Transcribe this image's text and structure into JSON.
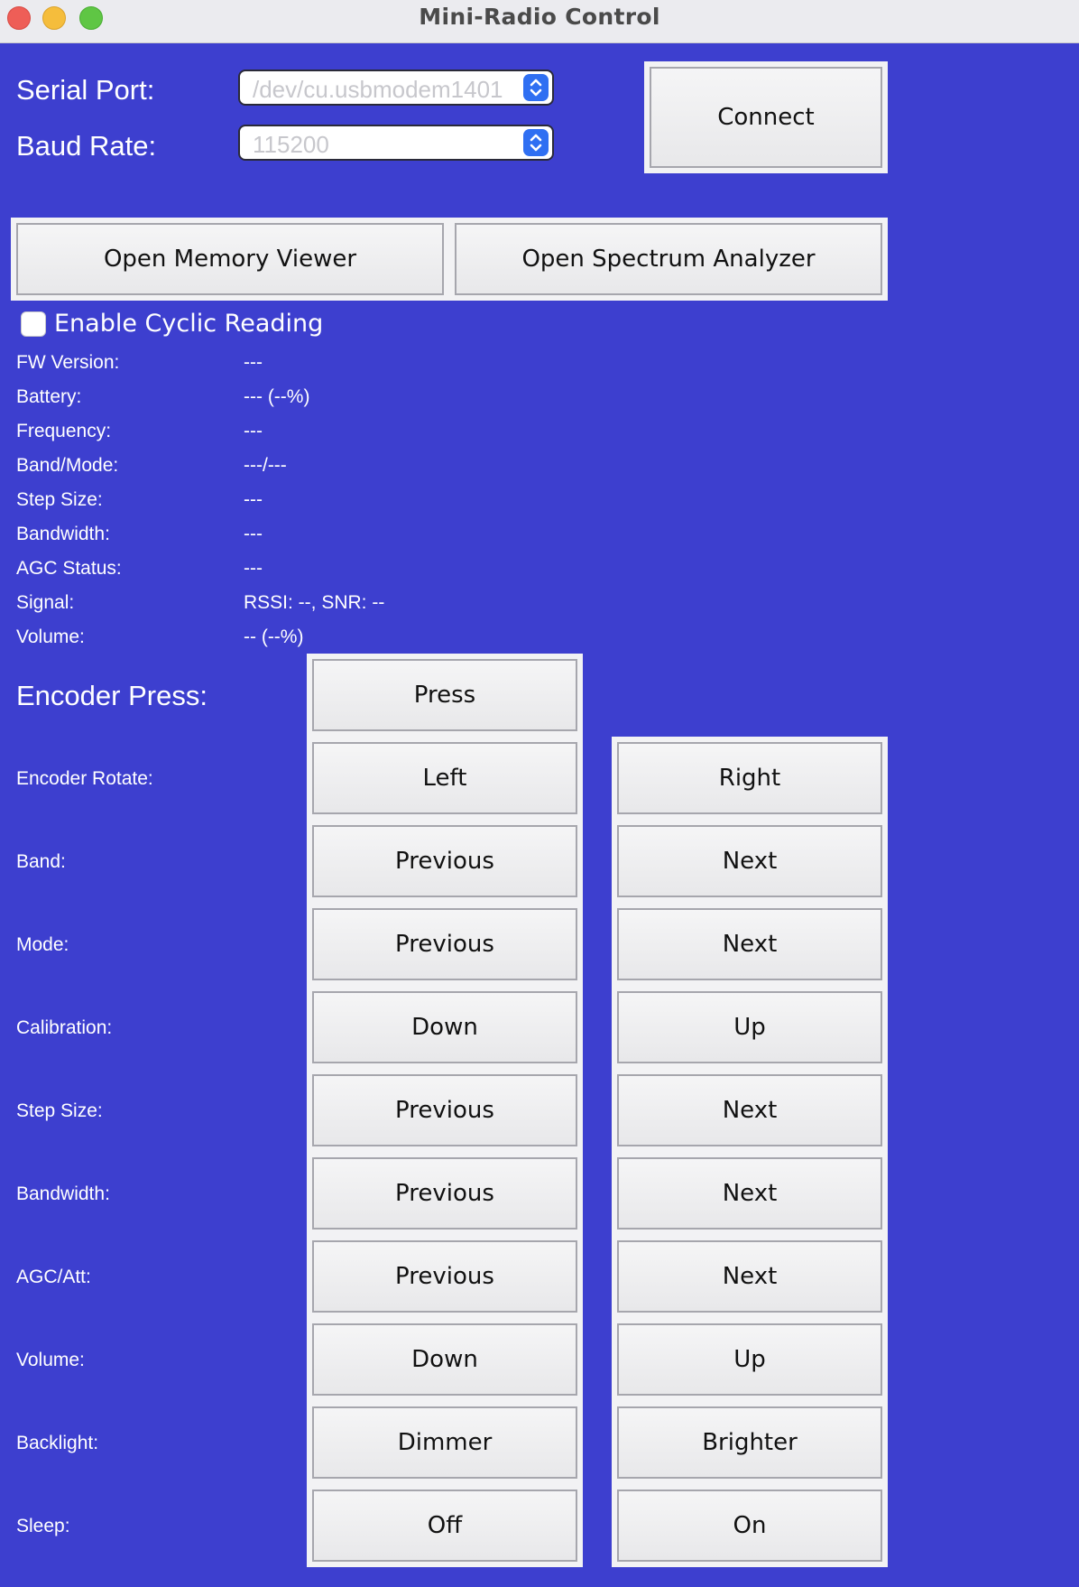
{
  "window": {
    "title": "Mini-Radio Control"
  },
  "connection": {
    "serial_port_label": "Serial Port:",
    "serial_port_value": "/dev/cu.usbmodem1401",
    "baud_rate_label": "Baud Rate:",
    "baud_rate_value": "115200",
    "connect_label": "Connect"
  },
  "tools": {
    "memory_viewer_label": "Open Memory Viewer",
    "spectrum_analyzer_label": "Open Spectrum Analyzer"
  },
  "cyclic": {
    "label": "Enable Cyclic Reading",
    "checked": false
  },
  "status": [
    {
      "label": "FW Version:",
      "value": "---"
    },
    {
      "label": "Battery:",
      "value": "--- (--%)"
    },
    {
      "label": "Frequency:",
      "value": "---"
    },
    {
      "label": "Band/Mode:",
      "value": "---/---"
    },
    {
      "label": "Step Size:",
      "value": "---"
    },
    {
      "label": "Bandwidth:",
      "value": "---"
    },
    {
      "label": "AGC Status:",
      "value": "---"
    },
    {
      "label": "Signal:",
      "value": "RSSI: --, SNR: --"
    },
    {
      "label": "Volume:",
      "value": "-- (--%)"
    }
  ],
  "encoder_press": {
    "label": "Encoder Press:",
    "button": "Press"
  },
  "controls": [
    {
      "label": "Encoder Rotate:",
      "left": "Left",
      "right": "Right"
    },
    {
      "label": "Band:",
      "left": "Previous",
      "right": "Next"
    },
    {
      "label": "Mode:",
      "left": "Previous",
      "right": "Next"
    },
    {
      "label": "Calibration:",
      "left": "Down",
      "right": "Up"
    },
    {
      "label": "Step Size:",
      "left": "Previous",
      "right": "Next"
    },
    {
      "label": "Bandwidth:",
      "left": "Previous",
      "right": "Next"
    },
    {
      "label": "AGC/Att:",
      "left": "Previous",
      "right": "Next"
    },
    {
      "label": "Volume:",
      "left": "Down",
      "right": "Up"
    },
    {
      "label": "Backlight:",
      "left": "Dimmer",
      "right": "Brighter"
    },
    {
      "label": "Sleep:",
      "left": "Off",
      "right": "On"
    }
  ],
  "colors": {
    "background": "#3d3fcf",
    "button_face": "#eeeef0",
    "stepper_accent": "#2f6ff2"
  }
}
